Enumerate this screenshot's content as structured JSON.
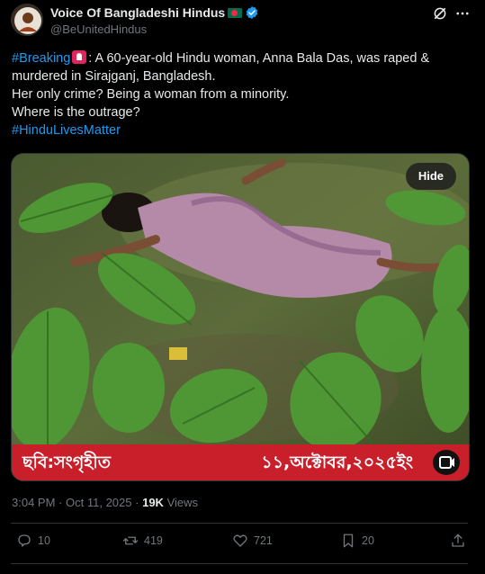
{
  "author": {
    "display_name": "Voice Of Bangladeshi Hindus",
    "handle": "@BeUnitedHindus"
  },
  "icons": {
    "verified": "verified-badge-icon",
    "flag": "bangladesh-flag-icon",
    "grok": "grok-icon",
    "more": "more-options-icon",
    "siren": "rotating-light-icon",
    "reply": "reply-icon",
    "retweet": "retweet-icon",
    "like": "like-icon",
    "bookmark": "bookmark-icon",
    "share": "share-icon",
    "video": "video-icon"
  },
  "tweet": {
    "hashtag_breaking": "#Breaking",
    "line1_rest": ": A 60-year-old Hindu woman, Anna Bala Das, was raped &",
    "line2": "murdered in Sirajganj, Bangladesh.",
    "line3": "Her only crime? Being a woman from a minority.",
    "line4": "Where is the outrage?",
    "hashtag_lives": "#HinduLivesMatter"
  },
  "media": {
    "hide_label": "Hide",
    "caption_left": "ছবি:সংগৃহীত",
    "caption_right": "১১,অক্টোবর,২০২৫ইং"
  },
  "meta": {
    "time": "3:04 PM",
    "separator": "·",
    "date": "Oct 11, 2025",
    "views_count": "19K",
    "views_label": "Views"
  },
  "actions": {
    "replies": "10",
    "retweets": "419",
    "likes": "721",
    "bookmarks": "20"
  },
  "colors": {
    "background": "#000000",
    "link": "#1d9bf0",
    "muted": "#71767b",
    "caption_red": "#c91f2a",
    "verified_blue": "#1d9bf0"
  }
}
